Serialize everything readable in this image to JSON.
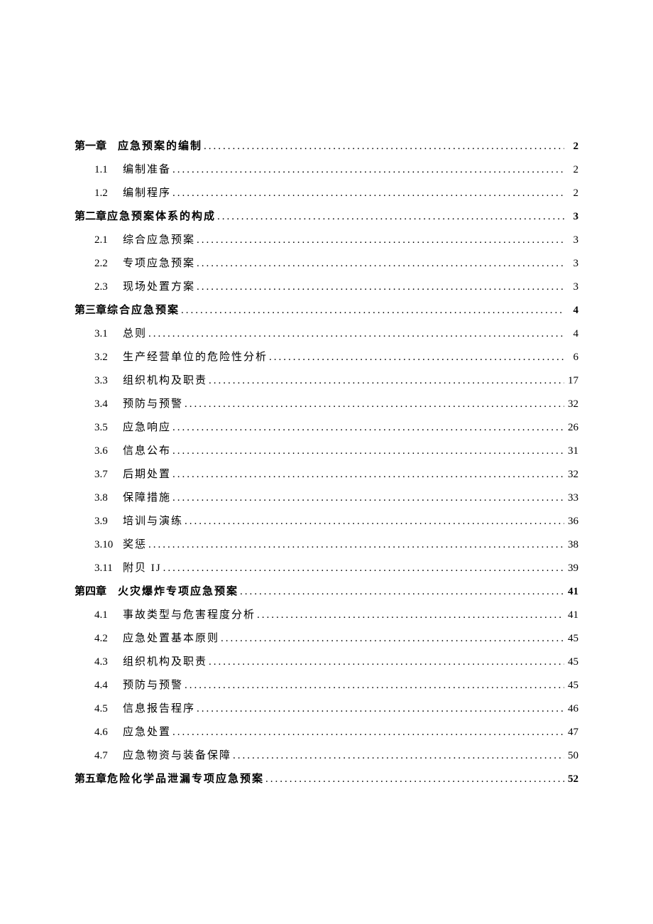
{
  "toc": [
    {
      "level": "chapter",
      "bold": true,
      "num": "第一章",
      "gap": true,
      "title": "应急预案的编制",
      "page": "2"
    },
    {
      "level": "sub",
      "bold": false,
      "num": "1.1",
      "gap": false,
      "title": "编制准备",
      "page": "2"
    },
    {
      "level": "sub",
      "bold": false,
      "num": "1.2",
      "gap": false,
      "title": "编制程序",
      "page": "2"
    },
    {
      "level": "chapter",
      "bold": true,
      "num": "第二章",
      "gap": false,
      "title": "应急预案体系的构成",
      "page": "3"
    },
    {
      "level": "sub",
      "bold": false,
      "num": "2.1",
      "gap": false,
      "title": "综合应急预案",
      "page": "3"
    },
    {
      "level": "sub",
      "bold": false,
      "num": "2.2",
      "gap": false,
      "title": "专项应急预案",
      "page": "3"
    },
    {
      "level": "sub",
      "bold": false,
      "num": "2.3",
      "gap": false,
      "title": "现场处置方案",
      "page": "3"
    },
    {
      "level": "chapter",
      "bold": true,
      "num": "第三章",
      "gap": false,
      "title": "综合应急预案",
      "page": "4"
    },
    {
      "level": "sub",
      "bold": false,
      "num": "3.1",
      "gap": false,
      "title": "总则",
      "page": "4"
    },
    {
      "level": "sub",
      "bold": false,
      "num": "3.2",
      "gap": false,
      "title": "生产经营单位的危险性分析",
      "page": "6"
    },
    {
      "level": "sub",
      "bold": false,
      "num": "3.3",
      "gap": false,
      "title": "组织机构及职责",
      "page": "17"
    },
    {
      "level": "sub",
      "bold": false,
      "num": "3.4",
      "gap": false,
      "title": "预防与预警",
      "page": "32"
    },
    {
      "level": "sub",
      "bold": false,
      "num": "3.5",
      "gap": false,
      "title": "应急响应",
      "page": "26"
    },
    {
      "level": "sub",
      "bold": false,
      "num": "3.6",
      "gap": false,
      "title": "信息公布",
      "page": "31"
    },
    {
      "level": "sub",
      "bold": false,
      "num": "3.7",
      "gap": false,
      "title": "后期处置",
      "page": "32"
    },
    {
      "level": "sub",
      "bold": false,
      "num": "3.8",
      "gap": false,
      "title": "保障措施",
      "page": "33"
    },
    {
      "level": "sub",
      "bold": false,
      "num": "3.9",
      "gap": false,
      "title": "培训与演练",
      "page": "36"
    },
    {
      "level": "sub",
      "bold": false,
      "num": "3.10",
      "gap": false,
      "title": "奖惩",
      "page": "38"
    },
    {
      "level": "sub",
      "bold": false,
      "num": "3.11",
      "gap": false,
      "title": "附贝 IJ",
      "page": "39"
    },
    {
      "level": "chapter",
      "bold": true,
      "num": "第四章",
      "gap": true,
      "title": "火灾爆炸专项应急预案",
      "page": "41"
    },
    {
      "level": "sub",
      "bold": false,
      "num": "4.1",
      "gap": false,
      "title": "事故类型与危害程度分析",
      "page": "41"
    },
    {
      "level": "sub",
      "bold": false,
      "num": "4.2",
      "gap": false,
      "title": "应急处置基本原则",
      "page": "45"
    },
    {
      "level": "sub",
      "bold": false,
      "num": "4.3",
      "gap": false,
      "title": "组织机构及职责",
      "page": "45"
    },
    {
      "level": "sub",
      "bold": false,
      "num": "4.4",
      "gap": false,
      "title": "预防与预警",
      "page": "45"
    },
    {
      "level": "sub",
      "bold": false,
      "num": "4.5",
      "gap": false,
      "title": "信息报告程序",
      "page": "46"
    },
    {
      "level": "sub",
      "bold": false,
      "num": "4.6",
      "gap": false,
      "title": "应急处置",
      "page": "47"
    },
    {
      "level": "sub",
      "bold": false,
      "num": "4.7",
      "gap": false,
      "title": "应急物资与装备保障",
      "page": "50"
    },
    {
      "level": "chapter",
      "bold": true,
      "num": "第五章",
      "gap": false,
      "title": "危险化学品泄漏专项应急预案",
      "page": "52"
    }
  ]
}
